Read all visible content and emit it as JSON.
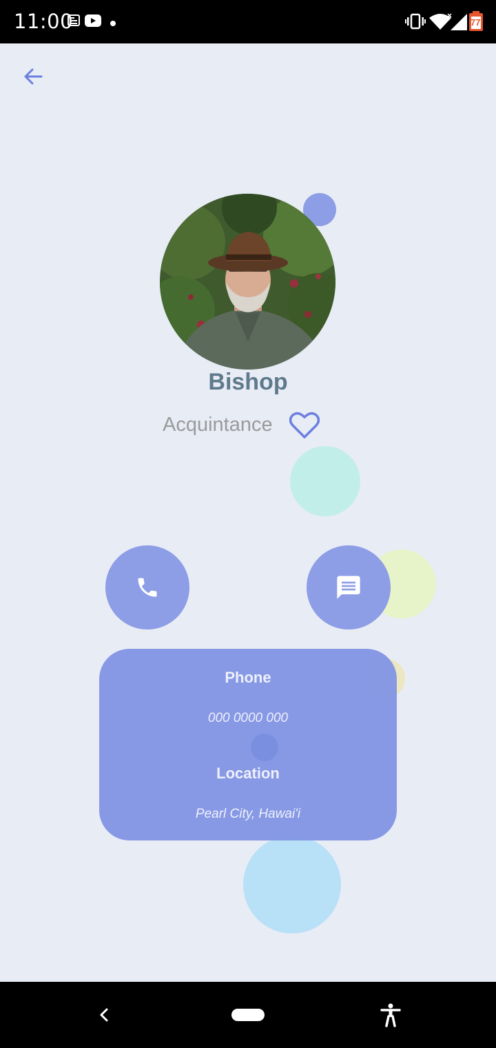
{
  "status_bar": {
    "time": "11:00",
    "battery_level": "77",
    "icons": [
      "news-icon",
      "youtube-icon",
      "dot-icon",
      "vibrate-icon",
      "wifi-icon",
      "signal-icon",
      "battery-icon"
    ]
  },
  "contact": {
    "name": "Bishop",
    "relation": "Acquintance",
    "favorite": true
  },
  "details": {
    "phone_label": "Phone",
    "phone_value": "000 0000 000",
    "location_label": "Location",
    "location_value": "Pearl City, Hawai'i"
  },
  "colors": {
    "accent": "#8d9de6",
    "background": "#e8ecf5",
    "name_color": "#5e7a8c",
    "heart": "#6b7fe0"
  }
}
